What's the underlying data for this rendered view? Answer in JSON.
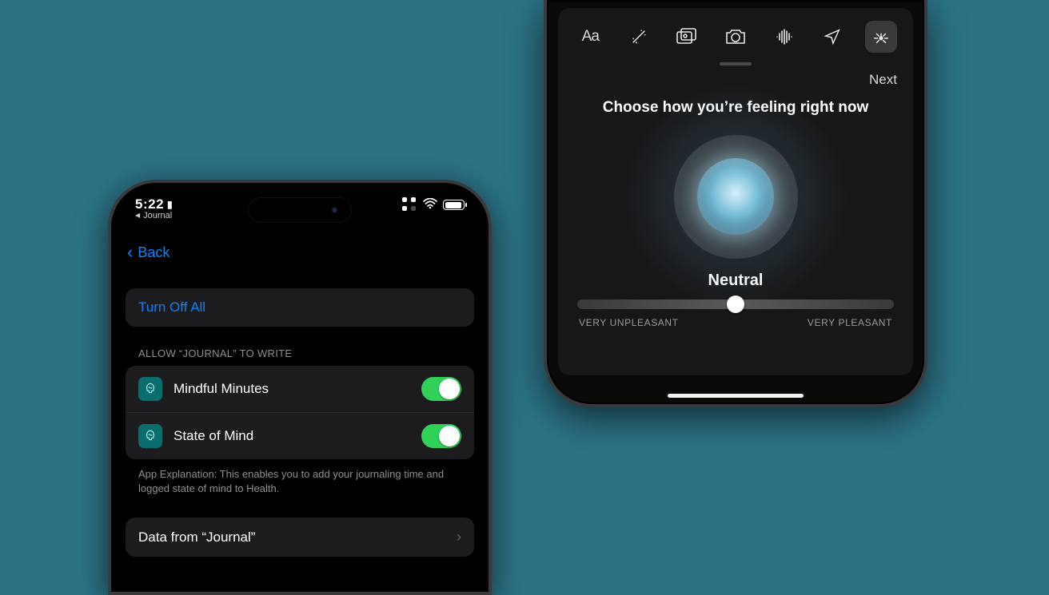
{
  "left": {
    "status": {
      "time": "5:22",
      "breadcrumb_app": "Journal"
    },
    "nav": {
      "back_label": "Back"
    },
    "turn_off": "Turn Off All",
    "section_header": "ALLOW “JOURNAL” TO WRITE",
    "rows": [
      {
        "label": "Mindful Minutes",
        "on": true
      },
      {
        "label": "State of Mind",
        "on": true
      }
    ],
    "footer": "App Explanation: This enables you to add your journaling time and logged state of mind to Health.",
    "data_row": "Data from “Journal”"
  },
  "right": {
    "toolbar_icons": [
      "text-style",
      "magic-wand",
      "photos",
      "camera",
      "audio-wave",
      "location",
      "state-of-mind-icon"
    ],
    "next": "Next",
    "prompt": "Choose how you’re feeling right now",
    "state": "Neutral",
    "slider": {
      "min_label": "VERY UNPLEASANT",
      "max_label": "VERY PLEASANT",
      "position_pct": 50
    }
  }
}
